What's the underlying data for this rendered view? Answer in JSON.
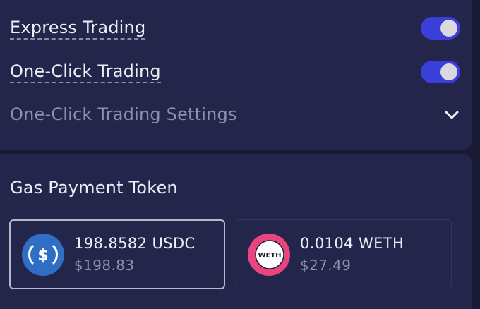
{
  "settings": {
    "express_trading": {
      "label": "Express Trading",
      "enabled": true
    },
    "one_click_trading": {
      "label": "One-Click Trading",
      "enabled": true
    },
    "one_click_settings": {
      "label": "One-Click Trading Settings"
    }
  },
  "gas": {
    "title": "Gas Payment Token",
    "tokens": [
      {
        "amount": "198.8582 USDC",
        "usd": "$198.83",
        "icon": "usdc-icon",
        "selected": true
      },
      {
        "amount": "0.0104 WETH",
        "usd": "$27.49",
        "icon": "weth-icon",
        "icon_text": "WETH",
        "selected": false
      }
    ]
  },
  "colors": {
    "toggle_on": "#3a3fd9",
    "usdc_blue": "#2f6ec4",
    "weth_pink": "#e8457f"
  }
}
